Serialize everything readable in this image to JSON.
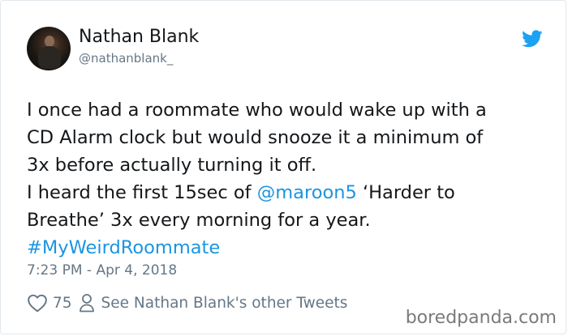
{
  "author": {
    "name": "Nathan Blank",
    "handle": "@nathanblank_"
  },
  "tweet": {
    "line1": "I once had a roommate who would wake up with a",
    "line2": "CD Alarm clock but would snooze it a minimum of",
    "line3": "3x before actually turning it off.",
    "line4_pre": "I heard the first 15sec of ",
    "line4_mention": "@maroon5",
    "line4_post": " ‘Harder to",
    "line5": "Breathe’ 3x every morning for a year.",
    "hashtag": "#MyWeirdRoommate"
  },
  "timestamp": "7:23 PM - Apr 4, 2018",
  "actions": {
    "likes": "75",
    "other_tweets": "See Nathan Blank's other Tweets"
  },
  "watermark": "boredpanda.com",
  "colors": {
    "link": "#1b95e0",
    "muted": "#657786",
    "text": "#14171a"
  },
  "icons": [
    "twitter-bird-icon",
    "heart-icon",
    "person-icon"
  ]
}
